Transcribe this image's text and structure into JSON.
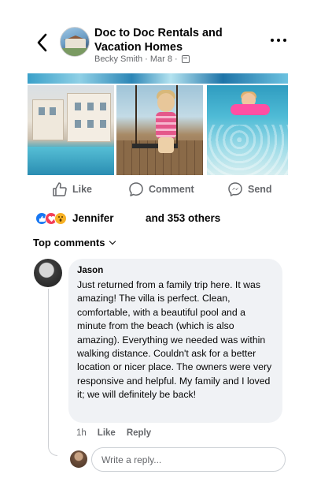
{
  "header": {
    "page_name": "Doc to Doc Rentals and Vacation Homes",
    "author": "Becky Smith",
    "separator": "·",
    "date": "Mar 8",
    "separator2": "·",
    "privacy_icon": "calendar-icon"
  },
  "actions": {
    "like_label": "Like",
    "comment_label": "Comment",
    "send_label": "Send"
  },
  "reactions": {
    "types": [
      "like",
      "love",
      "wow"
    ],
    "name": "Jennifer",
    "others_text": "and 353 others",
    "colors": {
      "like": "#1877f2",
      "love": "#f33e58",
      "wow": "#f7b125"
    }
  },
  "comments_header": {
    "label": "Top comments"
  },
  "comment": {
    "author": "Jason",
    "text": "Just returned from a family trip here. It was amazing! The villa is perfect. Clean, comfortable, with a beautiful pool and a minute from the beach (which is also amazing). Everything we needed was within walking distance. Couldn't ask for a better location or nicer place. The owners were very responsive and helpful. My family and I loved it; we will definitely be back!",
    "time": "1h",
    "like_label": "Like",
    "reply_label": "Reply"
  },
  "reply": {
    "placeholder": "Write a reply..."
  },
  "colors": {
    "accent": "#1877f2",
    "secondary_text": "#65676b",
    "bubble_bg": "#f0f2f5"
  }
}
